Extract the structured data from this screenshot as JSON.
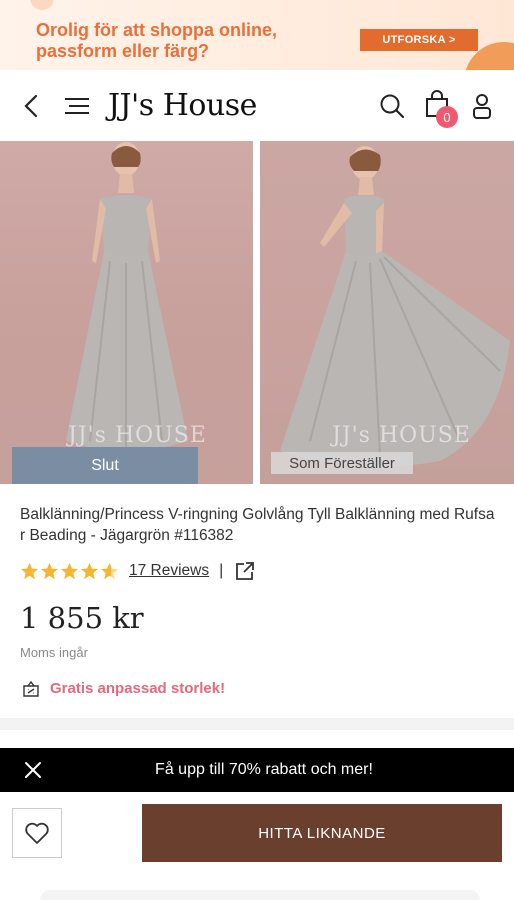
{
  "banner": {
    "text": "Orolig för att shoppa online, passform eller färg?",
    "cta_label": "UTFORSKA >"
  },
  "header": {
    "logo": "JJ's House",
    "cart_count": "0",
    "icons": [
      "chevron-left-icon",
      "menu-icon",
      "search-icon",
      "shopping-bag-icon",
      "user-icon"
    ]
  },
  "gallery": {
    "watermark": "JJ's HOUSE",
    "left_tag": "Slut",
    "right_tag": "Som Föreställer"
  },
  "product": {
    "title": "Balklänning/Princess V-ringning Golvlång Tyll Balklänning med Rufsar Beading - Jägargrön #116382",
    "rating": 4.5,
    "reviews_label": "17 Reviews",
    "separator": "|",
    "price": "1 855 kr",
    "vat_note": "Moms ingår",
    "free_size": "Gratis anpassad storlek!"
  },
  "promo": {
    "text": "Få upp till 70% rabatt och mer!"
  },
  "actions": {
    "find_similar": "HITTA LIKNANDE"
  },
  "colors": {
    "accent_orange": "#e26b2e",
    "brand_brown": "#6b3f2e",
    "pink": "#e5697d",
    "star": "#f5b52e"
  }
}
